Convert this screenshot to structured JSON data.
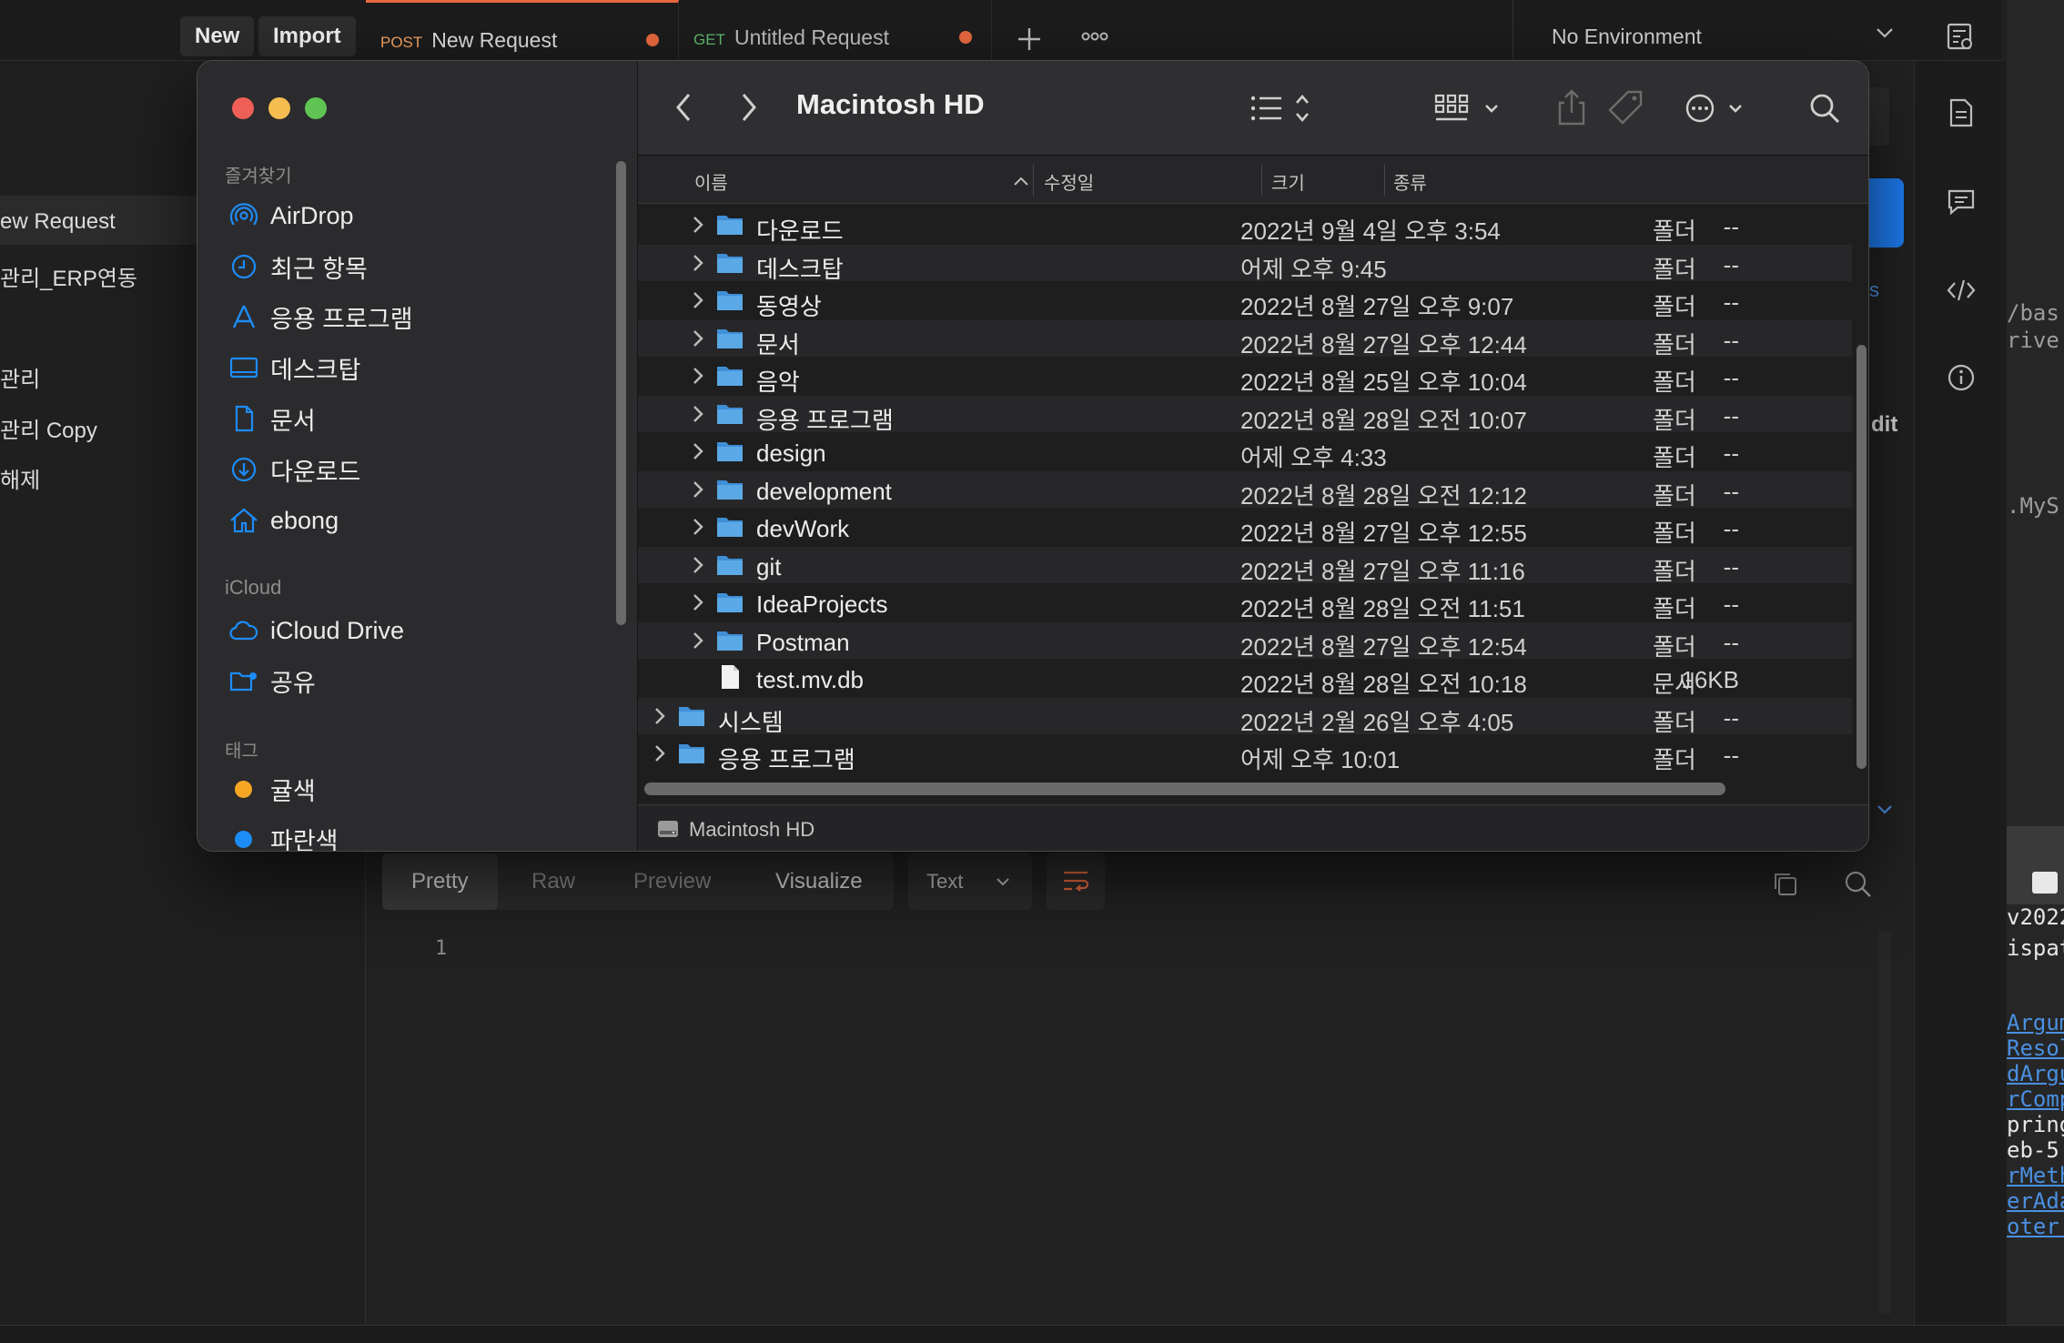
{
  "postman": {
    "new_label": "New",
    "import_label": "Import",
    "tabs": [
      {
        "method": "POST",
        "method_color": "#f4a261",
        "label": "New Request"
      },
      {
        "method": "GET",
        "method_color": "#5fb96f",
        "label": "Untitled Request"
      }
    ],
    "environment": "No Environment",
    "sidebar_items": [
      "ew Request",
      "관리_ERP연동",
      "관리",
      "관리 Copy",
      "해제"
    ],
    "right_panel_fragments": {
      "link": "s",
      "edit": "dit"
    },
    "response_tabs": [
      "Pretty",
      "Raw",
      "Preview",
      "Visualize"
    ],
    "format_select": "Text",
    "line_number": "1"
  },
  "ide_fragments": [
    "/bas",
    "rive",
    ".MyS",
    "v2022",
    "ispat",
    "Argum",
    "Resol",
    "dArgu",
    "rComp",
    "pring",
    "eb-5.",
    "rMeth",
    "erAda",
    "oter."
  ],
  "finder": {
    "title": "Macintosh HD",
    "sidebar": {
      "favorites_header": "즐겨찾기",
      "favorites": [
        {
          "icon": "airdrop-icon",
          "label": "AirDrop"
        },
        {
          "icon": "clock-icon",
          "label": "최근 항목"
        },
        {
          "icon": "applications-icon",
          "label": "응용 프로그램"
        },
        {
          "icon": "desktop-icon",
          "label": "데스크탑"
        },
        {
          "icon": "document-icon",
          "label": "문서"
        },
        {
          "icon": "download-icon",
          "label": "다운로드"
        },
        {
          "icon": "home-icon",
          "label": "ebong"
        }
      ],
      "icloud_header": "iCloud",
      "icloud": [
        {
          "icon": "cloud-icon",
          "label": "iCloud Drive"
        },
        {
          "icon": "shared-folder-icon",
          "label": "공유"
        }
      ],
      "tags_header": "태그",
      "tags": [
        {
          "label": "귤색",
          "color": "#f6a623"
        },
        {
          "label": "파란색",
          "color": "#1e8cf7"
        }
      ]
    },
    "columns": {
      "name": "이름",
      "modified": "수정일",
      "size": "크기",
      "kind": "종류"
    },
    "rows": [
      {
        "name": "다운로드",
        "date": "2022년 9월 4일 오후 3:54",
        "size": "--",
        "kind": "폴더",
        "level": 1,
        "type": "folder"
      },
      {
        "name": "데스크탑",
        "date": "어제 오후 9:45",
        "size": "--",
        "kind": "폴더",
        "level": 1,
        "type": "folder"
      },
      {
        "name": "동영상",
        "date": "2022년 8월 27일 오후 9:07",
        "size": "--",
        "kind": "폴더",
        "level": 1,
        "type": "folder"
      },
      {
        "name": "문서",
        "date": "2022년 8월 27일 오후 12:44",
        "size": "--",
        "kind": "폴더",
        "level": 1,
        "type": "folder"
      },
      {
        "name": "음악",
        "date": "2022년 8월 25일 오후 10:04",
        "size": "--",
        "kind": "폴더",
        "level": 1,
        "type": "folder"
      },
      {
        "name": "응용 프로그램",
        "date": "2022년 8월 28일 오전 10:07",
        "size": "--",
        "kind": "폴더",
        "level": 1,
        "type": "folder"
      },
      {
        "name": "design",
        "date": "어제 오후 4:33",
        "size": "--",
        "kind": "폴더",
        "level": 1,
        "type": "folder"
      },
      {
        "name": "development",
        "date": "2022년 8월 28일 오전 12:12",
        "size": "--",
        "kind": "폴더",
        "level": 1,
        "type": "folder"
      },
      {
        "name": "devWork",
        "date": "2022년 8월 27일 오후 12:55",
        "size": "--",
        "kind": "폴더",
        "level": 1,
        "type": "folder"
      },
      {
        "name": "git",
        "date": "2022년 8월 27일 오후 11:16",
        "size": "--",
        "kind": "폴더",
        "level": 1,
        "type": "folder"
      },
      {
        "name": "IdeaProjects",
        "date": "2022년 8월 28일 오전 11:51",
        "size": "--",
        "kind": "폴더",
        "level": 1,
        "type": "folder"
      },
      {
        "name": "Postman",
        "date": "2022년 8월 27일 오후 12:54",
        "size": "--",
        "kind": "폴더",
        "level": 1,
        "type": "folder"
      },
      {
        "name": "test.mv.db",
        "date": "2022년 8월 28일 오전 10:18",
        "size": "16KB",
        "kind": "문서",
        "level": 1,
        "type": "file"
      },
      {
        "name": "시스템",
        "date": "2022년 2월 26일 오후 4:05",
        "size": "--",
        "kind": "폴더",
        "level": 0,
        "type": "folder"
      },
      {
        "name": "응용 프로그램",
        "date": "어제 오후 10:01",
        "size": "--",
        "kind": "폴더",
        "level": 0,
        "type": "folder"
      }
    ],
    "pathbar": "Macintosh HD"
  },
  "colors": {
    "accent": "#1d7bf0",
    "folder": "#5aa9e6",
    "close": "#ee5f57",
    "minimize": "#f5bd4f",
    "maximize": "#5fc454",
    "dirty_dot": "#e8683f"
  }
}
